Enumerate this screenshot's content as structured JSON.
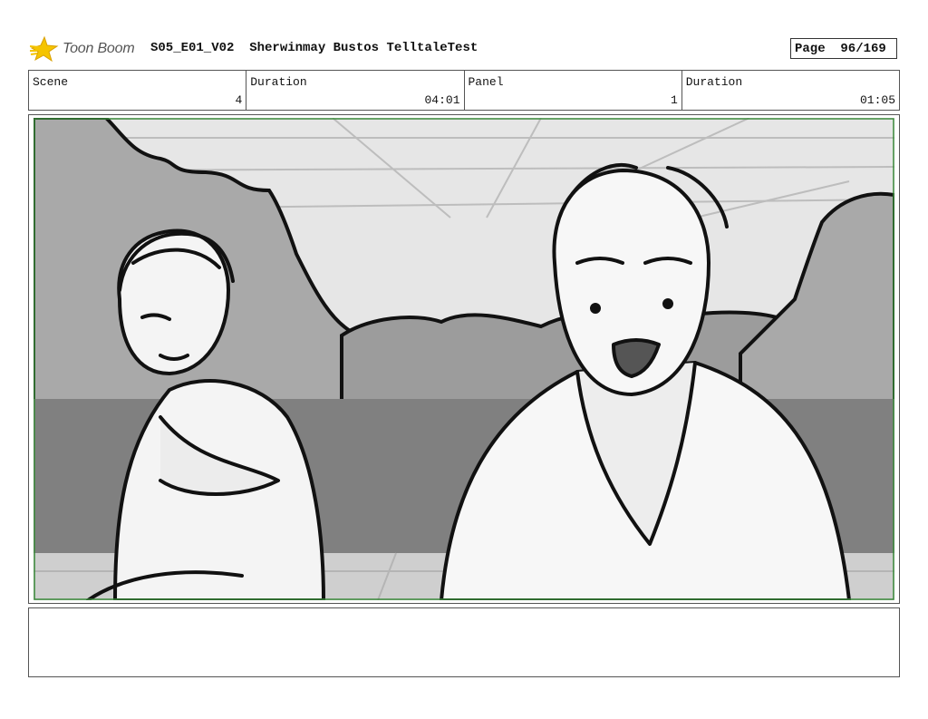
{
  "logo": {
    "text": "Toon Boom",
    "icon": "toon-boom-star-icon",
    "icon_color": "#f5c400"
  },
  "header": {
    "title": "S05_E01_V02  Sherwinmay Bustos TelltaleTest",
    "page": "Page  96/169"
  },
  "info": {
    "scene_label": "Scene",
    "scene_value": "4",
    "scene_duration_label": "Duration",
    "scene_duration_value": "04:01",
    "panel_label": "Panel",
    "panel_value": "1",
    "panel_duration_label": "Duration",
    "panel_duration_value": "01:05"
  },
  "panel": {
    "frame_color": "#3a8a3a",
    "colors": {
      "sky": "#e4e4e4",
      "trees": "#a8a8a8",
      "dark": "#7e7e7e",
      "ground": "#c8c8c8",
      "ink": "#111111"
    }
  },
  "notes": {
    "text": ""
  }
}
